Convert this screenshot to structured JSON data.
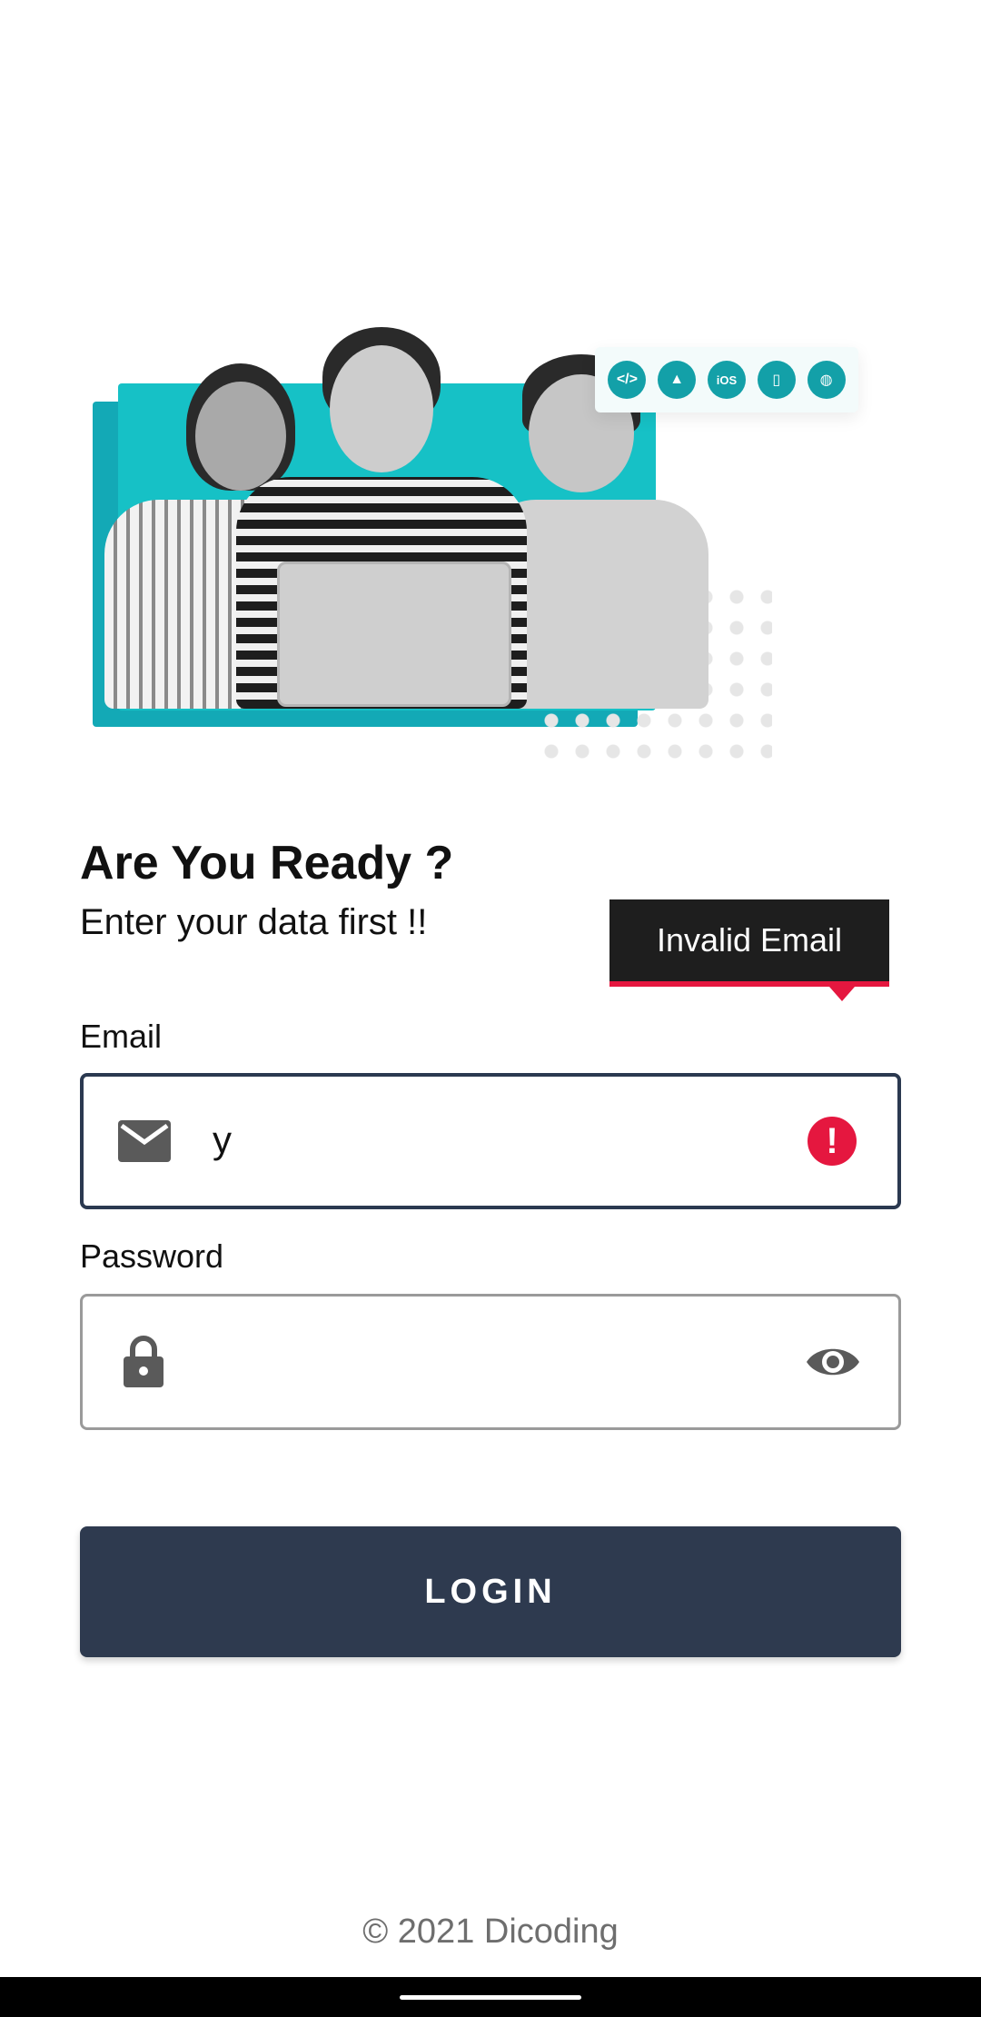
{
  "hero": {
    "platform_icons": [
      {
        "name": "code-icon",
        "glyph": "</>"
      },
      {
        "name": "android-icon",
        "glyph": "▲"
      },
      {
        "name": "ios-icon",
        "glyph": "iOS"
      },
      {
        "name": "multiplatform-icon",
        "glyph": "▯"
      },
      {
        "name": "web-icon",
        "glyph": "◍"
      }
    ]
  },
  "header": {
    "title": "Are You Ready ?",
    "subtitle": "Enter your data first !!"
  },
  "tooltip": {
    "text": "Invalid Email",
    "accent": "#e5173f"
  },
  "form": {
    "email_label": "Email",
    "email_value": "y",
    "password_label": "Password",
    "password_value": ""
  },
  "actions": {
    "login_label": "LOGIN"
  },
  "footer": {
    "copyright": "© 2021 Dicoding"
  },
  "colors": {
    "primary": "#2e3a4f",
    "accent_teal": "#16c1c6",
    "error": "#e5173f"
  }
}
